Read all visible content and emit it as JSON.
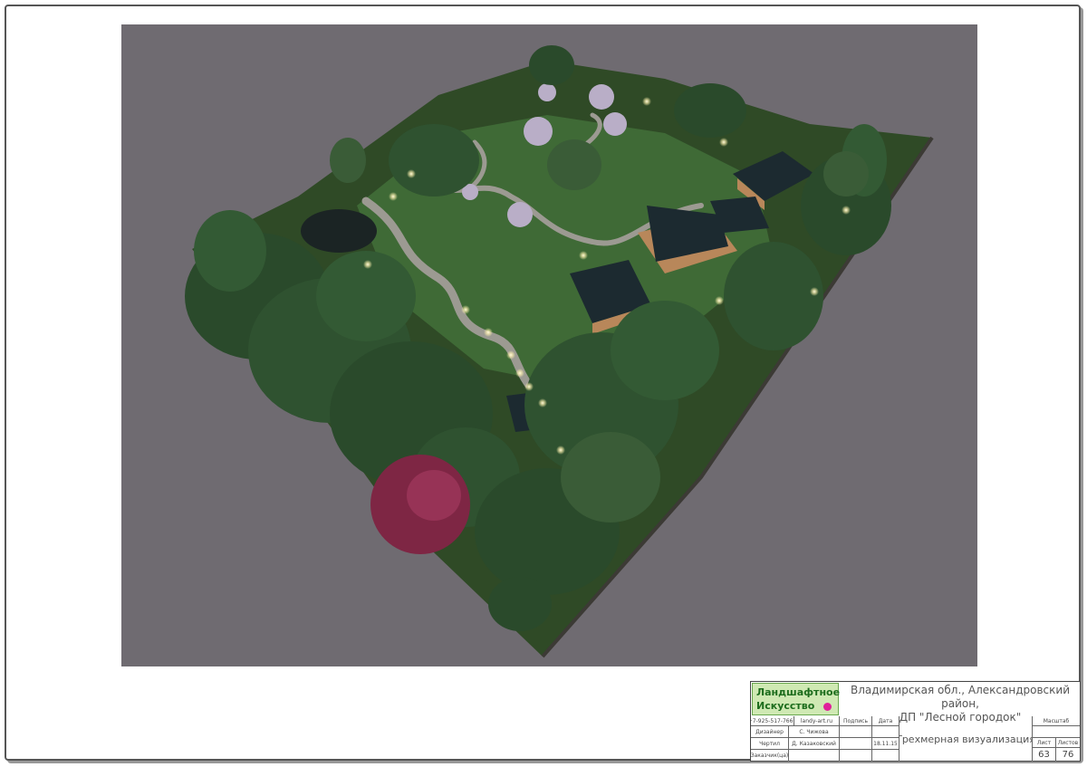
{
  "title_block": {
    "logo_line1": "Ландшафтное",
    "logo_line2": "Искусство",
    "address_line1": "Владимирская обл., Александровский район,",
    "address_line2": "ДП \"Лесной городок\"",
    "phone": "+7-925-517-7660",
    "website": "landy-art.ru",
    "col_signature": "Подпись",
    "col_date": "Дата",
    "row_designer_label": "Дизайнер",
    "row_designer_name": "С. Чижова",
    "row_drawn_label": "Чертил",
    "row_drawn_name": "Д. Казаковский",
    "row_drawn_date": "18.11.15",
    "row_customer_label": "Заказчик(ца)",
    "sheet_title": "Трехмерная визуализация",
    "scale_label": "Масштаб",
    "sheet_label": "Лист",
    "sheets_label": "Листов",
    "sheet_number": "63",
    "sheets_total": "76"
  },
  "colors": {
    "background": "#6f6b71",
    "ground": "#2f4a26",
    "tree_dark": "#2a4a2b",
    "tree_mid": "#3a5c37",
    "maple": "#8a2d4a",
    "roof": "#1c2a30",
    "house_wall": "#b8875a",
    "path": "#9c9a92",
    "light": "#fff6c8"
  }
}
